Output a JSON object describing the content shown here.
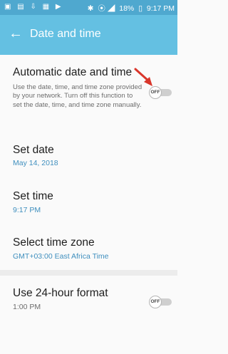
{
  "status_bar": {
    "left_icons": "▣ ▤ ⇩ ▦ ▶",
    "bluetooth": "✱",
    "signal": "⦿ ◢",
    "battery_pct": "18%",
    "battery_icon": "▯",
    "time": "9:17 PM"
  },
  "app_bar": {
    "back_icon": "←",
    "title": "Date and time"
  },
  "settings": {
    "auto": {
      "title": "Automatic date and time",
      "description": "Use the date, time, and time zone provided by your network. Turn off this function to set the date, time, and time zone manually.",
      "toggle_label": "OFF"
    },
    "set_date": {
      "title": "Set date",
      "value": "May 14, 2018"
    },
    "set_time": {
      "title": "Set time",
      "value": "9:17 PM"
    },
    "time_zone": {
      "title": "Select time zone",
      "value": "GMT+03:00 East Africa Time"
    },
    "format24": {
      "title": "Use 24-hour format",
      "value": "1:00 PM",
      "toggle_label": "OFF"
    }
  },
  "colors": {
    "status_bar": "#4fa8cf",
    "app_bar": "#64c0e2",
    "accent_text": "#3f8fbe",
    "annotation_arrow": "#d9362b"
  }
}
